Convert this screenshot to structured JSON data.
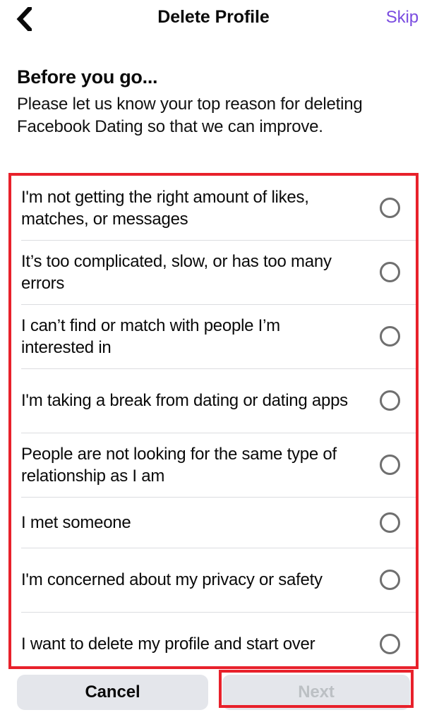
{
  "header": {
    "back_icon": "chevron-left-icon",
    "title": "Delete Profile",
    "skip_label": "Skip",
    "skip_color": "#7a4ce0"
  },
  "intro": {
    "heading": "Before you go...",
    "body": "Please let us know your top reason for deleting Facebook Dating so that we can improve."
  },
  "reasons": [
    {
      "label": "I'm not getting the right amount of likes, matches, or messages",
      "lines": 2,
      "selected": false
    },
    {
      "label": "It’s too complicated, slow, or has too many errors",
      "lines": 2,
      "selected": false
    },
    {
      "label": "I can’t find or match with people I’m interested in",
      "lines": 2,
      "selected": false
    },
    {
      "label": "I'm taking a break from dating or dating apps",
      "lines": 2,
      "selected": false
    },
    {
      "label": "People are not looking for the same type of relationship as I am",
      "lines": 2,
      "selected": false
    },
    {
      "label": "I met someone",
      "lines": 1,
      "selected": false
    },
    {
      "label": "I'm concerned about my privacy or safety",
      "lines": 2,
      "selected": false
    },
    {
      "label": "I want to delete my profile and start over",
      "lines": 2,
      "selected": false
    }
  ],
  "footer": {
    "cancel_label": "Cancel",
    "next_label": "Next",
    "next_disabled": true,
    "button_bg": "#e4e6eb",
    "next_text_color": "#bcc0c4"
  },
  "annotations": {
    "color": "#e8212b",
    "regions": [
      "reason-list",
      "next-button"
    ]
  }
}
